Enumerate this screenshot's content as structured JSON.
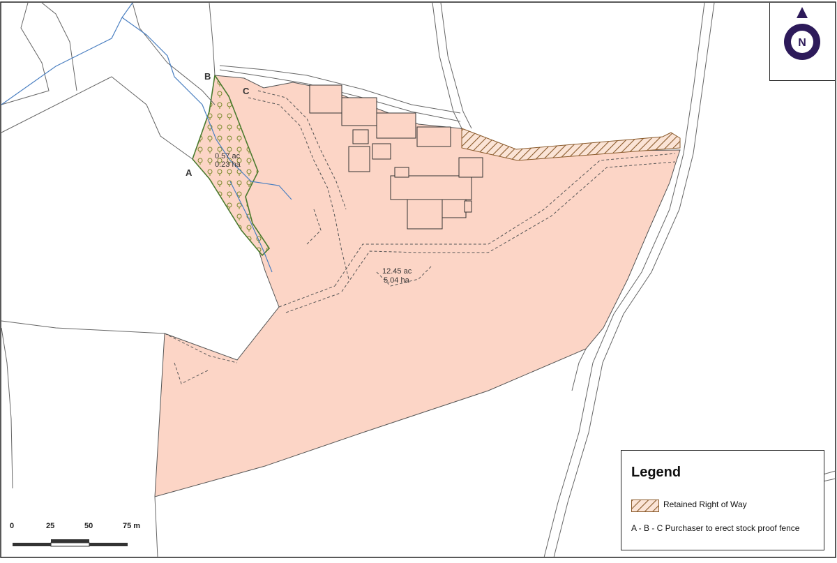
{
  "map": {
    "labels": {
      "a": "A",
      "b": "B",
      "c": "C"
    },
    "parcels": {
      "woodland": {
        "acres": "0.57 ac",
        "hectares": "0.23 ha"
      },
      "main": {
        "acres": "12.45 ac",
        "hectares": "5.04 ha"
      }
    },
    "colors": {
      "parcel_fill": "#fcd5c6",
      "woodland_outline": "#4a7a2e",
      "right_of_way": "#8a5a2b",
      "stream": "#4a7fc1",
      "lines": "#555555"
    }
  },
  "north": {
    "letter": "N",
    "color": "#2d1a5a"
  },
  "legend": {
    "title": "Legend",
    "items": [
      {
        "label": "Retained Right of Way",
        "swatch": "hatched-brown"
      },
      {
        "label": "A - B - C Purchaser to erect stock proof fence"
      }
    ]
  },
  "scale_bar": {
    "ticks": [
      "0",
      "25",
      "50",
      "75 m"
    ]
  }
}
